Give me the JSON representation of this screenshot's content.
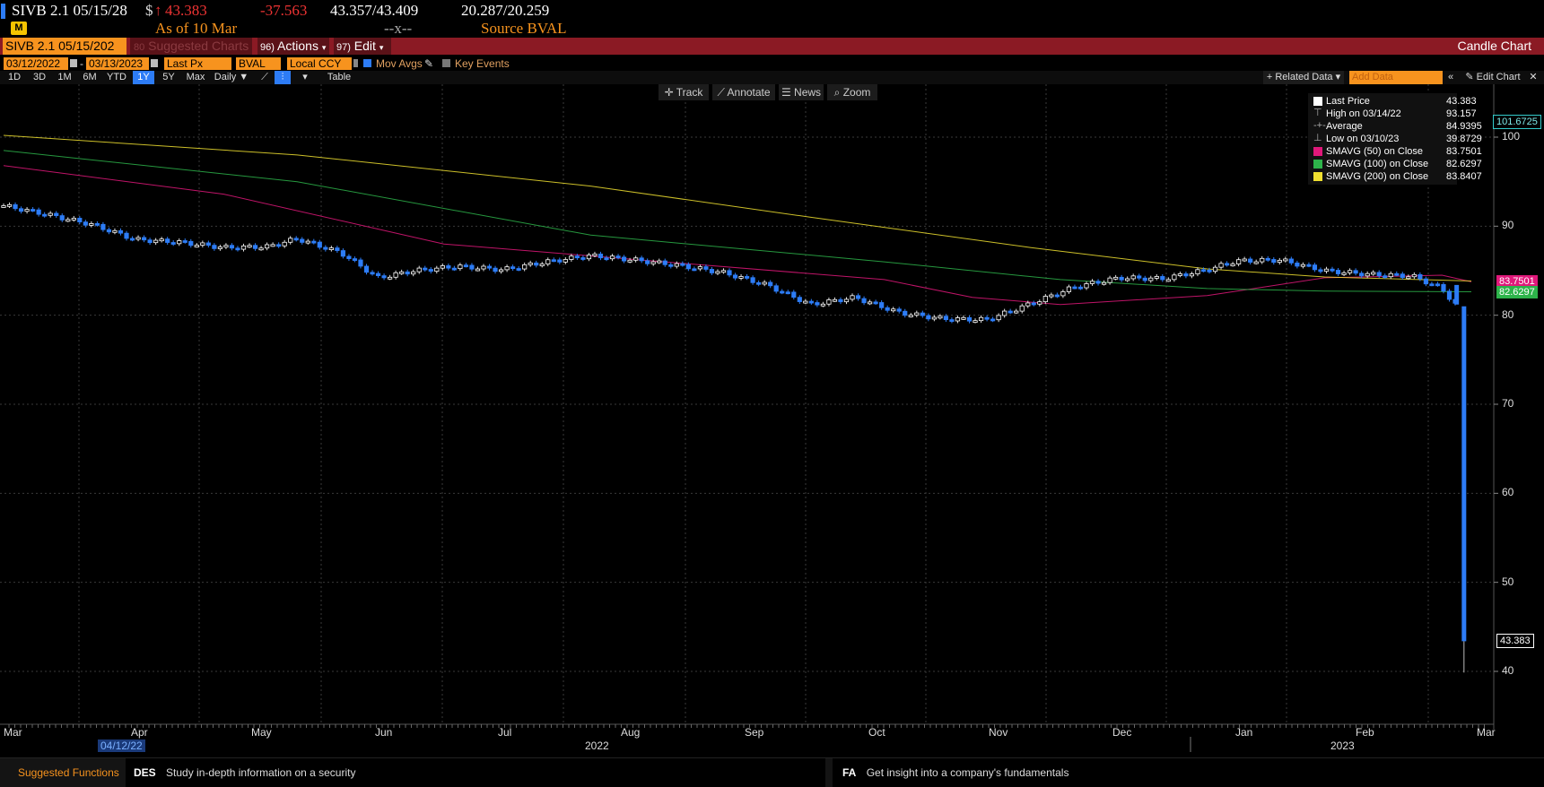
{
  "header": {
    "ticker": "SIVB 2.1 05/15/28",
    "currency_symbol": "$",
    "arrow": "↑",
    "last_price": "43.383",
    "change": "-37.563",
    "bid_ask": "43.357/43.409",
    "yield_bid_ask": "20.287/20.259",
    "as_of": "As of 10 Mar",
    "separator": "--x--",
    "source": "Source BVAL",
    "icon_letter": "M"
  },
  "menubar": {
    "security": "SIVB 2.1 05/15/202",
    "suggested_num": "80",
    "suggested": "Suggested Charts",
    "actions_num": "96)",
    "actions": "Actions",
    "edit_num": "97)",
    "edit": "Edit",
    "chart_type": "Candle Chart"
  },
  "params": {
    "start_date": "03/12/2022",
    "end_date": "03/13/2023",
    "field": "Last Px",
    "source": "BVAL",
    "currency": "Local CCY",
    "mov_avgs": "Mov Avgs",
    "key_events": "Key Events",
    "related_data": "+ Related Data",
    "add_data_placeholder": "Add Data",
    "edit_chart": "Edit Chart"
  },
  "periods": {
    "items": [
      "1D",
      "3D",
      "1M",
      "6M",
      "YTD",
      "1Y",
      "5Y",
      "Max"
    ],
    "selected": "1Y",
    "frequency": "Daily",
    "table": "Table"
  },
  "toolbar": {
    "track": "Track",
    "annotate": "Annotate",
    "news": "News",
    "zoom": "Zoom"
  },
  "legend": {
    "rows": [
      {
        "label": "Last Price",
        "value": "43.383",
        "color": "#ffffff"
      },
      {
        "label": "High on 03/14/22",
        "value": "93.157",
        "color": "#aaaaaa"
      },
      {
        "label": "Average",
        "value": "84.9395",
        "color": "#aaaaaa"
      },
      {
        "label": "Low on 03/10/23",
        "value": "39.8729",
        "color": "#aaaaaa"
      },
      {
        "label": "SMAVG (50)  on Close",
        "value": "83.7501",
        "color": "#e0187a"
      },
      {
        "label": "SMAVG (100)  on Close",
        "value": "82.6297",
        "color": "#2db34a"
      },
      {
        "label": "SMAVG (200)  on Close",
        "value": "83.8407",
        "color": "#f0e030"
      }
    ]
  },
  "right_axis": {
    "ticks": [
      "100",
      "90",
      "80",
      "70",
      "60",
      "50",
      "40"
    ],
    "top_tag": "101.6725",
    "sma50_tag": "83.7501",
    "sma100_tag": "82.6297",
    "last_tag": "43.383"
  },
  "x_axis": {
    "months": [
      "Mar",
      "Apr",
      "May",
      "Jun",
      "Jul",
      "Aug",
      "Sep",
      "Oct",
      "Nov",
      "Dec",
      "Jan",
      "Feb",
      "Mar"
    ],
    "years": [
      "2022",
      "2023"
    ],
    "highlight_date": "04/12/22"
  },
  "footer": {
    "suggested": "Suggested Functions",
    "des_code": "DES",
    "des_text": "Study in-depth information on a security",
    "fa_code": "FA",
    "fa_text": "Get insight into a company's fundamentals"
  },
  "colors": {
    "up": "#ffffff",
    "down": "#2d7cf6",
    "sma50": "#e0187a",
    "sma100": "#2db34a",
    "sma200": "#f0e030",
    "menubar": "#8b1a24",
    "accent": "#f7931e"
  },
  "chart_data": {
    "type": "candlestick",
    "y_range": [
      35,
      103
    ],
    "yticks": [
      40,
      50,
      60,
      70,
      80,
      90,
      100
    ],
    "close_path": [
      [
        0,
        92.3
      ],
      [
        0.03,
        91.3
      ],
      [
        0.06,
        90.2
      ],
      [
        0.09,
        88.5
      ],
      [
        0.12,
        88.2
      ],
      [
        0.15,
        87.6
      ],
      [
        0.18,
        87.7
      ],
      [
        0.2,
        88.6
      ],
      [
        0.23,
        87.0
      ],
      [
        0.255,
        84.2
      ],
      [
        0.28,
        85.0
      ],
      [
        0.31,
        85.5
      ],
      [
        0.34,
        85.1
      ],
      [
        0.37,
        86.0
      ],
      [
        0.4,
        86.7
      ],
      [
        0.43,
        86.2
      ],
      [
        0.46,
        85.6
      ],
      [
        0.49,
        84.8
      ],
      [
        0.52,
        83.4
      ],
      [
        0.55,
        81.2
      ],
      [
        0.58,
        82.0
      ],
      [
        0.61,
        80.3
      ],
      [
        0.64,
        79.6
      ],
      [
        0.67,
        79.5
      ],
      [
        0.7,
        81.3
      ],
      [
        0.73,
        83.2
      ],
      [
        0.76,
        84.2
      ],
      [
        0.79,
        84.1
      ],
      [
        0.82,
        85.1
      ],
      [
        0.84,
        86.1
      ],
      [
        0.87,
        86.2
      ],
      [
        0.9,
        85.0
      ],
      [
        0.93,
        84.6
      ],
      [
        0.96,
        84.4
      ],
      [
        0.98,
        83.0
      ],
      [
        0.99,
        81.0
      ],
      [
        1.0,
        43.383
      ]
    ],
    "series": [
      {
        "name": "SMAVG (50)",
        "points": [
          [
            0,
            96.8
          ],
          [
            0.15,
            93.6
          ],
          [
            0.3,
            88.0
          ],
          [
            0.45,
            86.0
          ],
          [
            0.6,
            84.0
          ],
          [
            0.66,
            82.0
          ],
          [
            0.72,
            81.2
          ],
          [
            0.82,
            82.2
          ],
          [
            0.9,
            84.2
          ],
          [
            0.98,
            84.5
          ],
          [
            1.0,
            83.75
          ]
        ]
      },
      {
        "name": "SMAVG (100)",
        "points": [
          [
            0,
            98.5
          ],
          [
            0.2,
            95.0
          ],
          [
            0.4,
            89.0
          ],
          [
            0.6,
            86.0
          ],
          [
            0.72,
            84.0
          ],
          [
            0.82,
            83.0
          ],
          [
            0.9,
            82.7
          ],
          [
            1.0,
            82.63
          ]
        ]
      },
      {
        "name": "SMAVG (200)",
        "points": [
          [
            0,
            100.2
          ],
          [
            0.2,
            98.0
          ],
          [
            0.4,
            94.5
          ],
          [
            0.55,
            91.0
          ],
          [
            0.7,
            87.6
          ],
          [
            0.82,
            85.2
          ],
          [
            0.9,
            84.3
          ],
          [
            1.0,
            83.84
          ]
        ]
      }
    ]
  }
}
